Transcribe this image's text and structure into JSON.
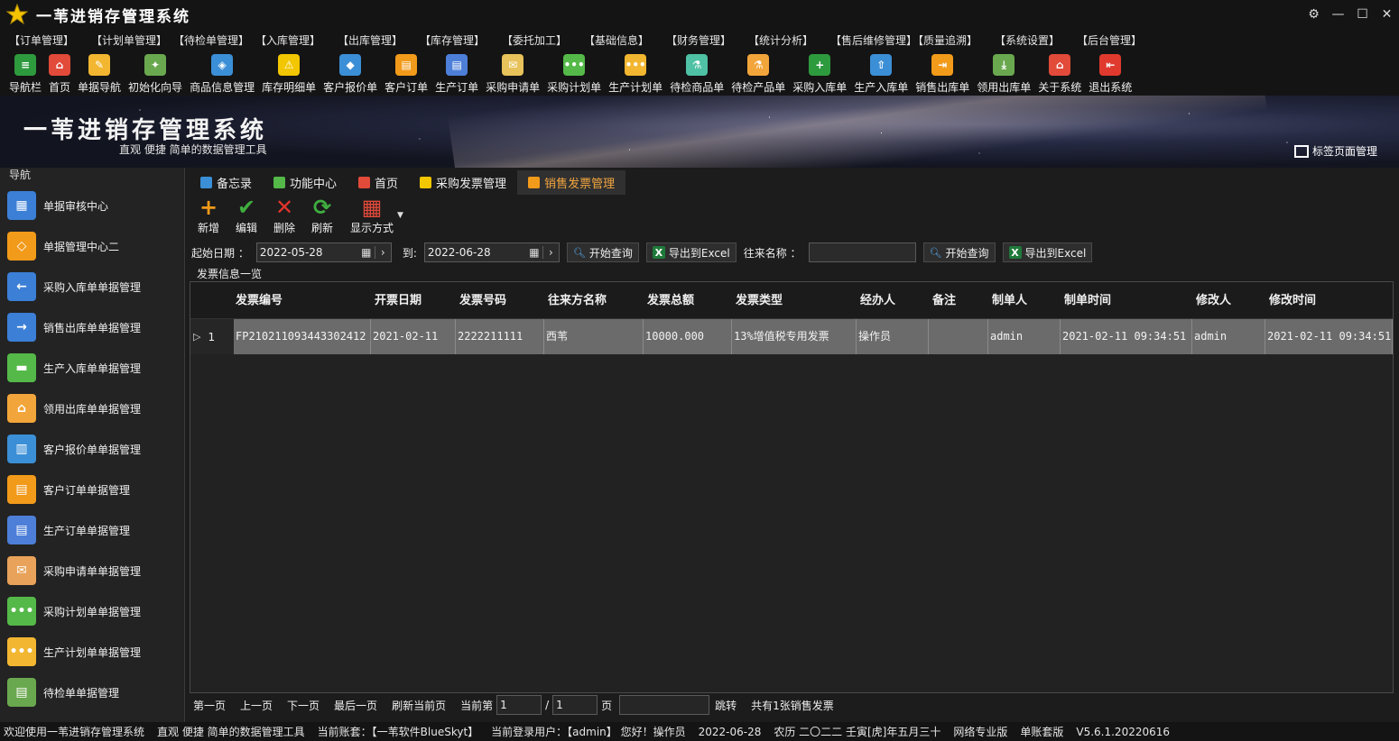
{
  "window": {
    "title": "一苇进销存管理系统",
    "controls": [
      "⚙",
      "—",
      "☐",
      "✕"
    ]
  },
  "menu": [
    "【订单管理】",
    "【计划单管理】",
    "【待检单管理】",
    "【入库管理】",
    "【出库管理】",
    "【库存管理】",
    "【委托加工】",
    "【基础信息】",
    "【财务管理】",
    "【统计分析】",
    "【售后维修管理】",
    "【质量追溯】",
    "【系统设置】",
    "【后台管理】"
  ],
  "toolbar": [
    {
      "label": "导航栏",
      "icon": "menu-lines-icon",
      "color": "#2e9a3e"
    },
    {
      "label": "首页",
      "icon": "home-icon",
      "color": "#e24a3a"
    },
    {
      "label": "单据导航",
      "icon": "pencil-star-icon",
      "color": "#f2b630"
    },
    {
      "label": "初始化向导",
      "icon": "magic-wand-icon",
      "color": "#6aa84f"
    },
    {
      "label": "商品信息管理",
      "icon": "cubes-icon",
      "color": "#3b8fd6"
    },
    {
      "label": "库存明细单",
      "icon": "warning-icon",
      "color": "#f2c600"
    },
    {
      "label": "客户报价单",
      "icon": "tag-icon",
      "color": "#3b8fd6"
    },
    {
      "label": "客户订单",
      "icon": "clipboard-orange-icon",
      "color": "#f29a1a"
    },
    {
      "label": "生产订单",
      "icon": "clipboard-blue-icon",
      "color": "#4d7fd9"
    },
    {
      "label": "采购申请单",
      "icon": "notepad-icon",
      "color": "#e8c25a"
    },
    {
      "label": "采购计划单",
      "icon": "chat-green-icon",
      "color": "#54b948"
    },
    {
      "label": "生产计划单",
      "icon": "chat-orange-icon",
      "color": "#f2b630"
    },
    {
      "label": "待检商品单",
      "icon": "flask-icon",
      "color": "#4fc1a4"
    },
    {
      "label": "待检产品单",
      "icon": "beaker-icon",
      "color": "#f2a53a"
    },
    {
      "label": "采购入库单",
      "icon": "plus-circle-icon",
      "color": "#2e9a3e"
    },
    {
      "label": "生产入库单",
      "icon": "hand-truck-icon",
      "color": "#3b8fd6"
    },
    {
      "label": "销售出库单",
      "icon": "export-box-icon",
      "color": "#f29a1a"
    },
    {
      "label": "领用出库单",
      "icon": "download-icon",
      "color": "#6aa84f"
    },
    {
      "label": "关于系统",
      "icon": "house-info-icon",
      "color": "#e24a3a"
    },
    {
      "label": "退出系统",
      "icon": "exit-door-icon",
      "color": "#e03a2e"
    }
  ],
  "banner": {
    "title": "一苇进销存管理系统",
    "subtitle": "直观 便捷 简单的数据管理工具",
    "tab_manager": "标签页面管理"
  },
  "sidebar": {
    "title": "导航",
    "items": [
      {
        "label": "单据审核中心",
        "icon": "grid-blue-icon",
        "color": "#3b7fd6"
      },
      {
        "label": "单据管理中心二",
        "icon": "grid-orange-icon",
        "color": "#f29a1a"
      },
      {
        "label": "采购入库单单据管理",
        "icon": "arrow-left-icon",
        "color": "#3b7fd6"
      },
      {
        "label": "销售出库单单据管理",
        "icon": "arrow-right-icon",
        "color": "#3b7fd6"
      },
      {
        "label": "生产入库单单据管理",
        "icon": "folder-green-icon",
        "color": "#54b948"
      },
      {
        "label": "领用出库单单据管理",
        "icon": "box-orange-icon",
        "color": "#f2a53a"
      },
      {
        "label": "客户报价单单据管理",
        "icon": "books-icon",
        "color": "#3b8fd6"
      },
      {
        "label": "客户订单单据管理",
        "icon": "clipboard-orange-icon",
        "color": "#f29a1a"
      },
      {
        "label": "生产订单单据管理",
        "icon": "clipboard-blue-icon",
        "color": "#4d7fd9"
      },
      {
        "label": "采购申请单单据管理",
        "icon": "envelope-icon",
        "color": "#e8a25a"
      },
      {
        "label": "采购计划单单据管理",
        "icon": "chat-green-icon",
        "color": "#54b948"
      },
      {
        "label": "生产计划单单据管理",
        "icon": "chat-orange-icon",
        "color": "#f2b630"
      },
      {
        "label": "待检单单据管理",
        "icon": "document-green-icon",
        "color": "#6aa84f"
      }
    ]
  },
  "tabs": [
    {
      "label": "备忘录",
      "icon": "memo-icon",
      "color": "#3b8fd6",
      "active": false
    },
    {
      "label": "功能中心",
      "icon": "apps-icon",
      "color": "#54b948",
      "active": false
    },
    {
      "label": "首页",
      "icon": "home-icon",
      "color": "#e24a3a",
      "active": false
    },
    {
      "label": "采购发票管理",
      "icon": "invoice-icon",
      "color": "#f2c600",
      "active": false
    },
    {
      "label": "销售发票管理",
      "icon": "invoice-orange-icon",
      "color": "#f29a1a",
      "active": true
    }
  ],
  "actions": [
    {
      "label": "新增",
      "glyph": "+",
      "color": "#f29a1a",
      "icon": "add-icon"
    },
    {
      "label": "编辑",
      "glyph": "✔",
      "color": "#3fae3f",
      "icon": "check-icon"
    },
    {
      "label": "删除",
      "glyph": "✕",
      "color": "#e0352b",
      "icon": "delete-icon"
    },
    {
      "label": "刷新",
      "glyph": "⟳",
      "color": "#3fae3f",
      "icon": "refresh-icon"
    },
    {
      "label": "显示方式",
      "glyph": "▦",
      "color": "#e24a3a",
      "icon": "grid-view-icon"
    }
  ],
  "filters": {
    "start_label": "起始日期 ：",
    "start_date": "2022-05-28",
    "to_label": "到:",
    "end_date": "2022-06-28",
    "query_button": "开始查询",
    "export_button": "导出到Excel",
    "partner_label": "往来名称 ：",
    "partner_value": "",
    "query_button2": "开始查询",
    "export_button2": "导出到Excel"
  },
  "group_title": "发票信息一览",
  "grid": {
    "columns": [
      "发票编号",
      "开票日期",
      "发票号码",
      "往来方名称",
      "发票总额",
      "发票类型",
      "经办人",
      "备注",
      "制单人",
      "制单时间",
      "修改人",
      "修改时间"
    ],
    "rows": [
      {
        "index": "1",
        "cells": [
          "FP210211093443302412",
          "2021-02-11",
          "2222211111",
          "西苇",
          "10000.000",
          "13%增值税专用发票",
          "操作员",
          "",
          "admin",
          "2021-02-11 09:34:51",
          "admin",
          "2021-02-11 09:34:51"
        ]
      }
    ]
  },
  "pager": {
    "first": "第一页",
    "prev": "上一页",
    "next": "下一页",
    "last": "最后一页",
    "refresh": "刷新当前页",
    "current_label": "当前第",
    "current": "1",
    "sep": "/",
    "total": "1",
    "page_unit": "页",
    "jump_value": "",
    "jump": "跳转",
    "summary": "共有1张销售发票"
  },
  "status": [
    "欢迎使用一苇进销存管理系统",
    "直观 便捷 简单的数据管理工具",
    "当前账套：【一苇软件BlueSkyt】",
    "当前登录用户：【admin】 您好！操作员",
    "2022-06-28",
    "农历 二〇二二 壬寅[虎]年五月三十",
    "网络专业版",
    "单账套版",
    "V5.6.1.20220616"
  ]
}
